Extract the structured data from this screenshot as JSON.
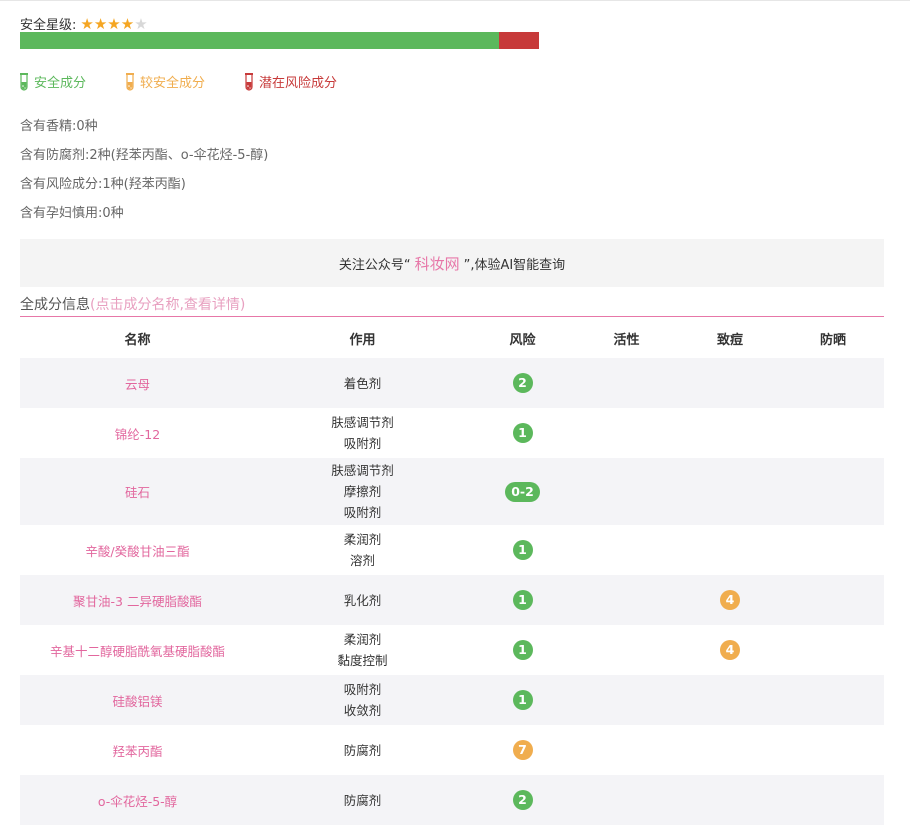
{
  "safety": {
    "label": "安全星级:",
    "stars_filled": 4,
    "stars_total": 5
  },
  "risk_bar": {
    "safe_fraction": 0.922,
    "safe_color": "#5cb85c",
    "risk_color": "#c73a3a"
  },
  "legend": [
    {
      "label": "安全成分",
      "color": "#5cb85c",
      "icon": "test-tube-icon"
    },
    {
      "label": "较安全成分",
      "color": "#f0ad4e",
      "icon": "test-tube-icon"
    },
    {
      "label": "潜在风险成分",
      "color": "#c73a3a",
      "icon": "test-tube-icon"
    }
  ],
  "facts": [
    "含有香精:0种",
    "含有防腐剂:2种(羟苯丙酯、o-伞花烃-5-醇)",
    "含有风险成分:1种(羟苯丙酯)",
    "含有孕妇慎用:0种"
  ],
  "banner": {
    "prefix": "关注公众号“",
    "brand": "科妆网",
    "suffix": "”,体验AI智能查询"
  },
  "section": {
    "title": "全成分信息",
    "hint": "(点击成分名称,查看详情)"
  },
  "colors": {
    "green": "#5cb85c",
    "orange": "#f0ad4e",
    "pink": "#e2679e"
  },
  "table": {
    "headers": [
      "名称",
      "作用",
      "风险",
      "活性",
      "致痘",
      "防晒"
    ],
    "rows": [
      {
        "name": "云母",
        "functions": [
          "着色剂"
        ],
        "risk": "2",
        "risk_color": "green",
        "active": "",
        "acne": "",
        "acne_color": "",
        "sunscreen": ""
      },
      {
        "name": "锦纶-12",
        "functions": [
          "肤感调节剂",
          "吸附剂"
        ],
        "risk": "1",
        "risk_color": "green",
        "active": "",
        "acne": "",
        "acne_color": "",
        "sunscreen": ""
      },
      {
        "name": "硅石",
        "functions": [
          "肤感调节剂",
          "摩擦剂",
          "吸附剂"
        ],
        "risk": "0-2",
        "risk_color": "green",
        "active": "",
        "acne": "",
        "acne_color": "",
        "sunscreen": ""
      },
      {
        "name": "辛酸/癸酸甘油三酯",
        "functions": [
          "柔润剂",
          "溶剂"
        ],
        "risk": "1",
        "risk_color": "green",
        "active": "",
        "acne": "",
        "acne_color": "",
        "sunscreen": ""
      },
      {
        "name": "聚甘油-3 二异硬脂酸酯",
        "functions": [
          "乳化剂"
        ],
        "risk": "1",
        "risk_color": "green",
        "active": "",
        "acne": "4",
        "acne_color": "orange",
        "sunscreen": ""
      },
      {
        "name": "辛基十二醇硬脂酰氧基硬脂酸酯",
        "functions": [
          "柔润剂",
          "黏度控制"
        ],
        "risk": "1",
        "risk_color": "green",
        "active": "",
        "acne": "4",
        "acne_color": "orange",
        "sunscreen": ""
      },
      {
        "name": "硅酸铝镁",
        "functions": [
          "吸附剂",
          "收敛剂"
        ],
        "risk": "1",
        "risk_color": "green",
        "active": "",
        "acne": "",
        "acne_color": "",
        "sunscreen": ""
      },
      {
        "name": "羟苯丙酯",
        "functions": [
          "防腐剂"
        ],
        "risk": "7",
        "risk_color": "orange",
        "active": "",
        "acne": "",
        "acne_color": "",
        "sunscreen": ""
      },
      {
        "name": "o-伞花烃-5-醇",
        "functions": [
          "防腐剂"
        ],
        "risk": "2",
        "risk_color": "green",
        "active": "",
        "acne": "",
        "acne_color": "",
        "sunscreen": ""
      }
    ]
  }
}
